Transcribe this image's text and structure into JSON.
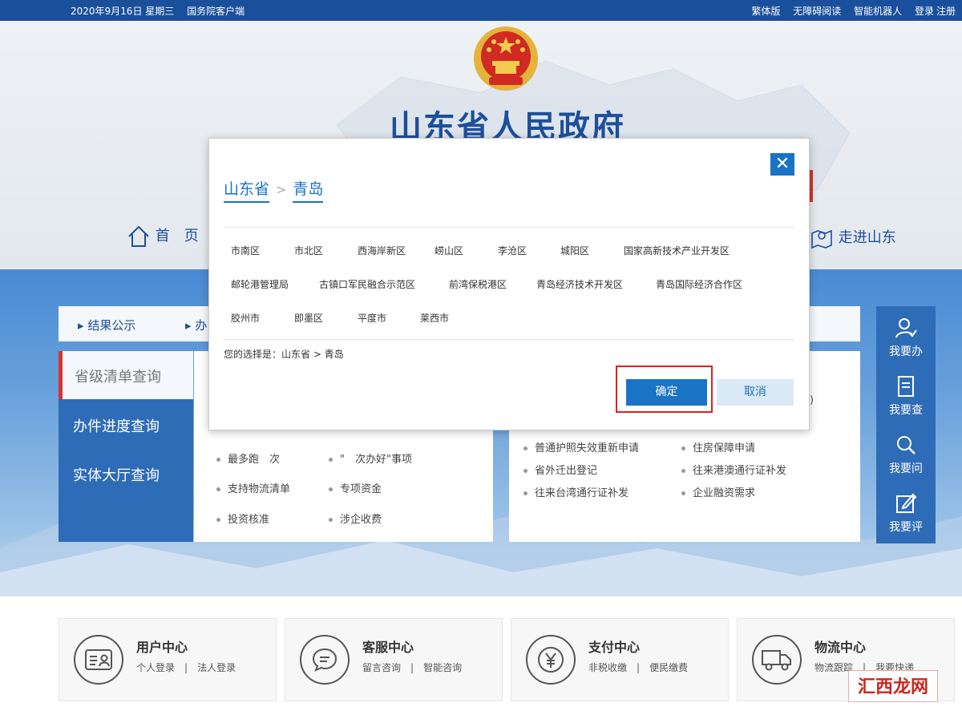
{
  "topbar": {
    "date": "2020年9月16日 星期三",
    "client": "国务院客户端",
    "traditional": "繁体版",
    "accessible": "无障碍阅读",
    "robot": "智能机器人",
    "login": "登录",
    "register": "注册"
  },
  "header": {
    "title": "山东省人民政府",
    "nav_home": "首　页",
    "nav_right": "走进山东"
  },
  "tabs": {
    "result_notice": "结果公示",
    "second": "办"
  },
  "left_menu": [
    "省级清单查询",
    "办件进度查询",
    "实体大厅查询"
  ],
  "panel_a": {
    "items": [
      "最多跑　次",
      "\"　次办好\"事项",
      "支持物流清单",
      "专项资金",
      "投资核准",
      "涉企收费"
    ]
  },
  "panel_b": {
    "items": [
      "普通护照失效重新申请",
      "住房保障申请",
      "省外迁出登记",
      "往来港澳通行证补发",
      "往来台湾通行证补发",
      "企业融资需求"
    ],
    "partial": ")"
  },
  "sidebar": [
    "我要办",
    "我要查",
    "我要问",
    "我要评"
  ],
  "services": [
    {
      "title": "用户中心",
      "link1": "个人登录",
      "link2": "法人登录"
    },
    {
      "title": "客服中心",
      "link1": "留言咨询",
      "link2": "智能咨询"
    },
    {
      "title": "支付中心",
      "link1": "非税收缴",
      "link2": "便民缴费"
    },
    {
      "title": "物流中心",
      "link1": "物流跟踪",
      "link2": "我要快递"
    }
  ],
  "modal": {
    "close_glyph": "✕",
    "crumb_province": "山东省",
    "crumb_sep": ">",
    "crumb_city": "青岛",
    "districts": [
      "市南区",
      "市北区",
      "西海岸新区",
      "崂山区",
      "李沧区",
      "城阳区",
      "国家高新技术产业开发区",
      "邮轮港管理局",
      "古镇口军民融合示范区",
      "前湾保税港区",
      "青岛经济技术开发区",
      "青岛国际经济合作区",
      "胶州市",
      "即墨区",
      "平度市",
      "莱西市"
    ],
    "selection": "您的选择是：山东省 > 青岛",
    "confirm": "确定",
    "cancel": "取消"
  },
  "watermark": "汇西龙网"
}
